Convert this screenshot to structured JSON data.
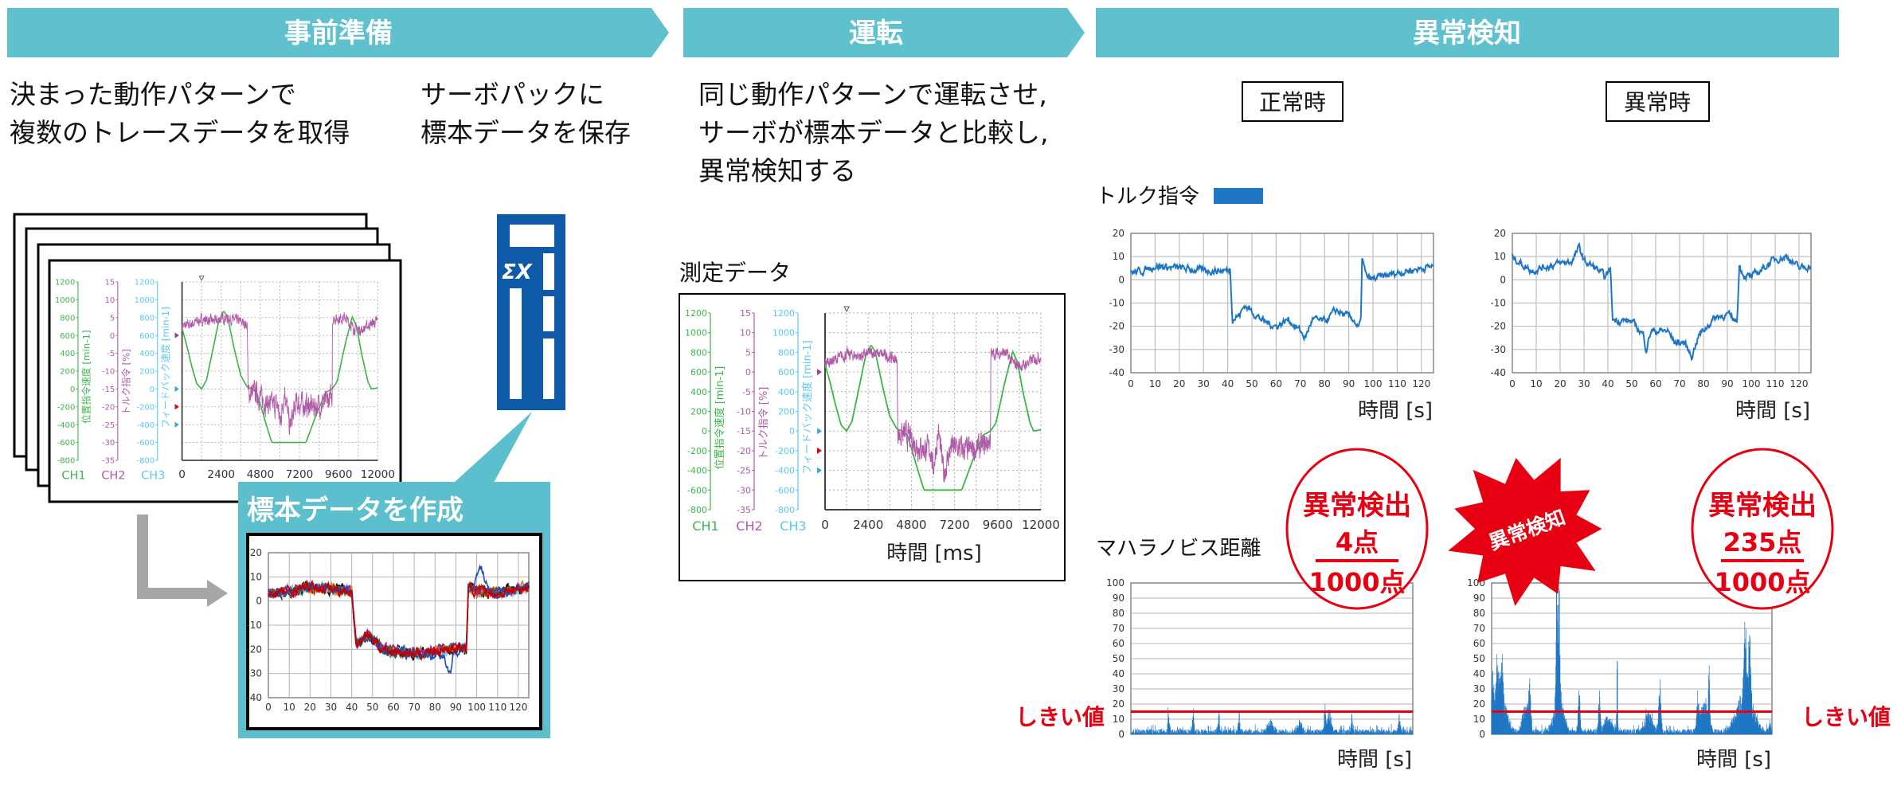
{
  "headers": {
    "prep": "事前準備",
    "run": "運転",
    "detect": "異常検知"
  },
  "prep": {
    "text1": [
      "決まった動作パターンで",
      "複数のトレースデータを取得"
    ],
    "text2": [
      "サーボパックに",
      "標本データを保存"
    ],
    "callout_title": "標本データを作成",
    "servopack_logo": "ΣX"
  },
  "run": {
    "text": [
      "同じ動作パターンで運転させ,",
      "サーボが標本データと比較し,",
      "異常検知する"
    ],
    "measured_label": "測定データ"
  },
  "detect": {
    "normal_label": "正常時",
    "abnormal_label": "異常時",
    "torque_legend": "トルク指令",
    "mahalanobis_label": "マハラノビス距離",
    "threshold_label": "しきい値",
    "badge": "異常検知",
    "normal_result": {
      "title": "異常検出",
      "count": "4点",
      "total": "1000点"
    },
    "abnormal_result": {
      "title": "異常検出",
      "count": "235点",
      "total": "1000点"
    }
  },
  "colors": {
    "header": "#5fc1ce",
    "callout": "#5bbfcd",
    "servopack": "#0f5aa8",
    "alert": "#e60012",
    "torque": "#1f77c4",
    "arrow": "#a6a6a6"
  },
  "chart_data": {
    "trace": {
      "type": "line",
      "xlim": [
        0,
        12000
      ],
      "xticks": [
        0,
        2400,
        4800,
        7200,
        9600,
        12000
      ],
      "xlabel": "時間 [ms]",
      "grid": "dotted",
      "channels": [
        {
          "name": "CH1",
          "label": "位置指令速度 [min-1]",
          "color": "#3cb54a",
          "ylim": [
            -800,
            1200
          ],
          "ticks": [
            1200,
            1000,
            800,
            600,
            400,
            200,
            0,
            -200,
            -400,
            -600,
            -800
          ]
        },
        {
          "name": "CH2",
          "label": "トルク指令 [%]",
          "color": "#b05aa8",
          "ylim": [
            -35,
            15
          ],
          "ticks": [
            15,
            10,
            5,
            0,
            -5,
            -10,
            -15,
            -20,
            -25,
            -30,
            -35
          ]
        },
        {
          "name": "CH3",
          "label": "フィードバック速度 [min-1]",
          "color": "#5bc8ef",
          "ylim": [
            -800,
            1200
          ],
          "ticks": [
            1200,
            1000,
            800,
            600,
            400,
            200,
            0,
            -200,
            -400,
            -600,
            -800
          ]
        }
      ],
      "series": [
        {
          "channel": "CH1",
          "points": [
            [
              0,
              680
            ],
            [
              300,
              480
            ],
            [
              600,
              250
            ],
            [
              900,
              60
            ],
            [
              1200,
              0
            ],
            [
              1500,
              100
            ],
            [
              1900,
              450
            ],
            [
              2250,
              760
            ],
            [
              2550,
              876
            ],
            [
              2800,
              800
            ],
            [
              3200,
              450
            ],
            [
              3600,
              150
            ],
            [
              4000,
              20
            ],
            [
              4300,
              0
            ],
            [
              4600,
              -50
            ],
            [
              5000,
              -300
            ],
            [
              5500,
              -600
            ],
            [
              7600,
              -600
            ],
            [
              8200,
              -300
            ],
            [
              8800,
              -40
            ],
            [
              9200,
              0
            ],
            [
              9500,
              80
            ],
            [
              10000,
              500
            ],
            [
              10430,
              811
            ],
            [
              10700,
              700
            ],
            [
              11000,
              400
            ],
            [
              11400,
              80
            ],
            [
              11600,
              0
            ],
            [
              12000,
              13
            ]
          ]
        },
        {
          "channel": "CH2",
          "points": [
            [
              0,
              2.5
            ],
            [
              500,
              3
            ],
            [
              1200,
              4.5
            ],
            [
              2000,
              4
            ],
            [
              2600,
              5
            ],
            [
              3500,
              4
            ],
            [
              4000,
              3
            ],
            [
              4050,
              -16
            ],
            [
              4500,
              -16
            ],
            [
              5200,
              -19
            ],
            [
              5900,
              -20
            ],
            [
              6000,
              -25
            ],
            [
              6300,
              -15
            ],
            [
              6600,
              -26
            ],
            [
              7000,
              -19
            ],
            [
              8000,
              -20
            ],
            [
              8800,
              -19
            ],
            [
              9200,
              -17
            ],
            [
              9220,
              4.5
            ],
            [
              10000,
              5
            ],
            [
              10500,
              2
            ],
            [
              11000,
              1.5
            ],
            [
              11500,
              3
            ],
            [
              12000,
              4
            ]
          ]
        }
      ]
    },
    "torque_normal": {
      "type": "line",
      "xlim": [
        0,
        125
      ],
      "ylim": [
        -40,
        20
      ],
      "xticks": [
        0,
        10,
        20,
        30,
        40,
        50,
        60,
        70,
        80,
        90,
        100,
        110,
        120
      ],
      "yticks": [
        20,
        10,
        0,
        -10,
        -20,
        -30,
        -40
      ],
      "xlabel": "時間 [s]",
      "grid": true,
      "points": [
        [
          0,
          3
        ],
        [
          5,
          4
        ],
        [
          10,
          6
        ],
        [
          20,
          5
        ],
        [
          30,
          4
        ],
        [
          40,
          4
        ],
        [
          41,
          5
        ],
        [
          42,
          -17
        ],
        [
          45,
          -15
        ],
        [
          47,
          -11
        ],
        [
          55,
          -18
        ],
        [
          60,
          -20
        ],
        [
          65,
          -17
        ],
        [
          70,
          -22
        ],
        [
          72,
          -25
        ],
        [
          75,
          -17
        ],
        [
          80,
          -18
        ],
        [
          85,
          -13
        ],
        [
          88,
          -15
        ],
        [
          92,
          -17
        ],
        [
          94,
          -21
        ],
        [
          95,
          -18
        ],
        [
          95.5,
          10
        ],
        [
          97,
          2
        ],
        [
          99,
          0
        ],
        [
          110,
          3
        ],
        [
          125,
          6
        ]
      ]
    },
    "torque_abnormal": {
      "type": "line",
      "xlim": [
        0,
        125
      ],
      "ylim": [
        -40,
        20
      ],
      "xticks": [
        0,
        10,
        20,
        30,
        40,
        50,
        60,
        70,
        80,
        90,
        100,
        110,
        120
      ],
      "yticks": [
        20,
        10,
        0,
        -10,
        -20,
        -30,
        -40
      ],
      "xlabel": "時間 [s]",
      "grid": true,
      "points": [
        [
          0,
          10
        ],
        [
          5,
          6
        ],
        [
          8,
          4
        ],
        [
          15,
          6
        ],
        [
          20,
          7
        ],
        [
          25,
          8
        ],
        [
          28,
          14
        ],
        [
          30,
          8
        ],
        [
          35,
          5
        ],
        [
          39,
          1
        ],
        [
          41,
          5
        ],
        [
          42,
          -17
        ],
        [
          50,
          -18
        ],
        [
          55,
          -24
        ],
        [
          56,
          -30
        ],
        [
          58,
          -22
        ],
        [
          65,
          -22
        ],
        [
          68,
          -27
        ],
        [
          72,
          -27
        ],
        [
          75,
          -33
        ],
        [
          78,
          -24
        ],
        [
          85,
          -16
        ],
        [
          90,
          -15
        ],
        [
          94,
          -18
        ],
        [
          95,
          6
        ],
        [
          97,
          2
        ],
        [
          100,
          1
        ],
        [
          105,
          5
        ],
        [
          110,
          9
        ],
        [
          115,
          10
        ],
        [
          120,
          5
        ],
        [
          125,
          6
        ]
      ]
    },
    "sample": {
      "type": "line",
      "xlim": [
        0,
        125
      ],
      "ylim": [
        -40,
        20
      ],
      "xticks": [
        0,
        10,
        20,
        30,
        40,
        50,
        60,
        70,
        80,
        90,
        100,
        110,
        120
      ],
      "yticks": [
        20,
        10,
        0,
        -10,
        -20,
        -30,
        -40
      ],
      "grid": true,
      "base": [
        [
          0,
          3
        ],
        [
          10,
          4
        ],
        [
          20,
          6
        ],
        [
          30,
          5
        ],
        [
          40,
          4
        ],
        [
          42,
          -17
        ],
        [
          45,
          -16
        ],
        [
          48,
          -14
        ],
        [
          55,
          -20
        ],
        [
          70,
          -22
        ],
        [
          85,
          -20
        ],
        [
          92,
          -19
        ],
        [
          95,
          -20
        ],
        [
          96,
          6
        ],
        [
          100,
          4
        ],
        [
          110,
          3
        ],
        [
          125,
          6
        ]
      ],
      "series": [
        {
          "color": "#2e8b57"
        },
        {
          "color": "#000000"
        },
        {
          "color": "#ff7f0e"
        },
        {
          "color": "#87ceeb"
        },
        {
          "color": "#a020a0"
        },
        {
          "color": "#8b4513"
        },
        {
          "color": "#1f4fb0",
          "override": [
            [
              84,
              -22
            ],
            [
              87,
              -30
            ],
            [
              89,
              -22
            ],
            [
              98,
              4
            ],
            [
              101,
              12
            ],
            [
              103,
              13
            ],
            [
              106,
              4
            ]
          ]
        },
        {
          "color": "#c00000"
        }
      ]
    },
    "mahalanobis_normal": {
      "type": "bar",
      "xlim": [
        0,
        125
      ],
      "ylim": [
        0,
        100
      ],
      "yticks": [
        100,
        90,
        80,
        70,
        60,
        50,
        40,
        30,
        20,
        10,
        0
      ],
      "xlabel": "時間 [s]",
      "threshold": 15,
      "points": 1000,
      "peaks": [
        [
          16.7,
          18,
          0.3
        ],
        [
          27.6,
          17,
          0.3
        ],
        [
          39,
          14,
          0.3
        ],
        [
          48,
          12,
          0.4
        ],
        [
          86,
          22,
          0.3
        ],
        [
          88,
          16,
          0.8
        ],
        [
          98,
          13,
          0.3
        ],
        [
          119,
          12,
          0.4
        ],
        [
          62,
          8,
          1
        ],
        [
          75,
          7,
          1
        ]
      ]
    },
    "mahalanobis_abnormal": {
      "type": "bar",
      "xlim": [
        0,
        125
      ],
      "ylim": [
        0,
        100
      ],
      "yticks": [
        100,
        90,
        80,
        70,
        60,
        50,
        40,
        30,
        20,
        10,
        0
      ],
      "xlabel": "時間 [s]",
      "threshold": 15,
      "points": 1000,
      "peaks": [
        [
          0.5,
          50,
          0.6
        ],
        [
          2.5,
          52,
          0.6
        ],
        [
          4.5,
          42,
          0.6
        ],
        [
          5,
          22,
          2
        ],
        [
          15,
          20,
          1.2
        ],
        [
          17,
          32,
          0.5
        ],
        [
          29,
          100,
          0.3
        ],
        [
          30,
          85,
          0.4
        ],
        [
          30,
          28,
          2
        ],
        [
          39,
          35,
          0.4
        ],
        [
          48,
          30,
          0.4
        ],
        [
          52,
          12,
          1.5
        ],
        [
          56,
          64,
          0.2
        ],
        [
          70,
          15,
          1.5
        ],
        [
          75,
          35,
          0.5
        ],
        [
          92,
          23,
          0.5
        ],
        [
          95,
          22,
          1.5
        ],
        [
          97,
          43,
          0.3
        ],
        [
          113,
          57,
          0.5
        ],
        [
          115,
          53,
          0.5
        ],
        [
          113,
          30,
          3.5
        ],
        [
          124,
          8,
          0.4
        ]
      ]
    }
  }
}
